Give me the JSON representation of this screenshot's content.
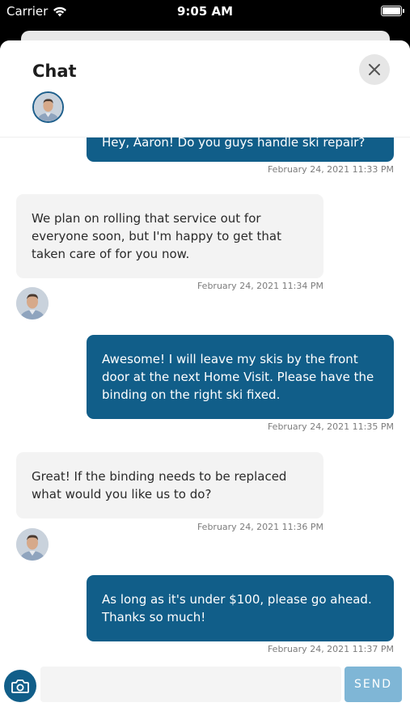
{
  "status_bar": {
    "carrier": "Carrier",
    "time": "9:05 AM",
    "wifi_icon": "wifi-icon",
    "battery_icon": "battery-icon"
  },
  "header": {
    "title": "Chat",
    "close_icon": "close-icon"
  },
  "messages": [
    {
      "from": "me",
      "text": "Hey, Aaron! Do you guys handle ski repair?",
      "timestamp": "February 24, 2021 11:33 PM"
    },
    {
      "from": "them",
      "text": "We plan on rolling that service out for everyone soon, but I'm happy to get that taken care of for you now.",
      "timestamp": "February 24, 2021 11:34 PM"
    },
    {
      "from": "me",
      "text": "Awesome! I will leave my skis by the front door at the next Home Visit. Please have the binding on the right ski fixed.",
      "timestamp": "February 24, 2021 11:35 PM"
    },
    {
      "from": "them",
      "text": "Great! If the binding needs to be replaced what would you like us to do?",
      "timestamp": "February 24, 2021 11:36 PM"
    },
    {
      "from": "me",
      "text": "As long as it's under $100, please go ahead. Thanks so much!",
      "timestamp": "February 24, 2021 11:37 PM"
    }
  ],
  "composer": {
    "value": "",
    "send_label": "SEND",
    "camera_icon": "camera-icon"
  },
  "colors": {
    "accent": "#115e89",
    "bubble_them": "#f3f3f3",
    "send_disabled": "#7fb6d6"
  }
}
